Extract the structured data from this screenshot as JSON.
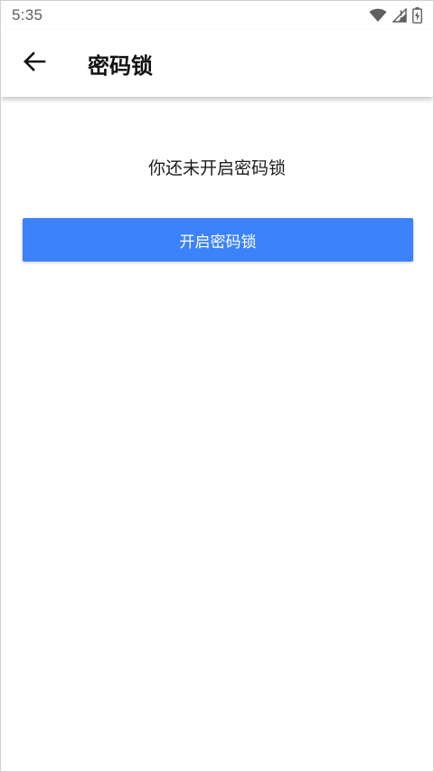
{
  "status_bar": {
    "time": "5:35",
    "icons": [
      "wifi-icon",
      "cell-signal-icon",
      "battery-charging-icon"
    ]
  },
  "app_bar": {
    "back_icon": "arrow-left-icon",
    "title": "密码锁"
  },
  "main": {
    "status_message": "你还未开启密码锁",
    "enable_button_label": "开启密码锁"
  },
  "colors": {
    "accent": "#3b82fb",
    "status_icon": "#5f5f5f",
    "title_text": "#111111"
  }
}
